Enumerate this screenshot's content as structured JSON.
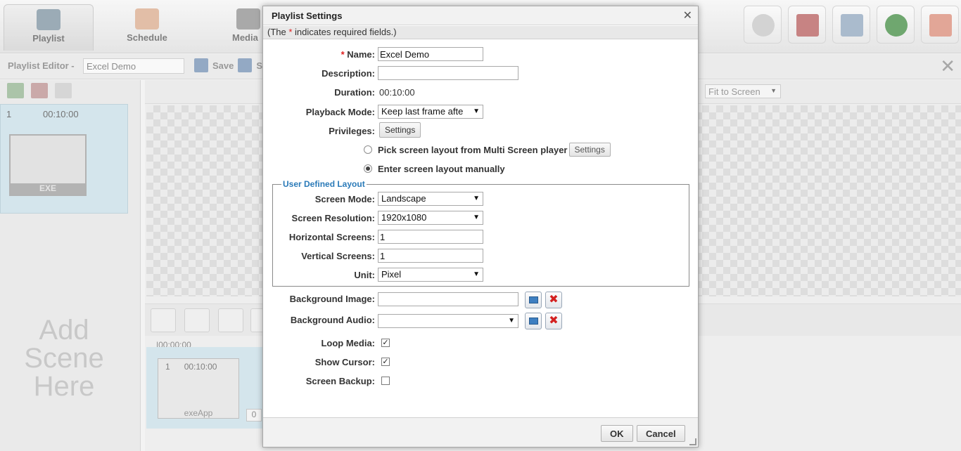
{
  "app": {
    "nav_tabs": [
      {
        "label": "Playlist",
        "icon": "playlist-icon"
      },
      {
        "label": "Schedule",
        "icon": "calendar-icon"
      },
      {
        "label": "Media",
        "icon": "media-icon"
      }
    ],
    "editor": {
      "label": "Playlist Editor -",
      "playlist_name": "Excel Demo",
      "save_label": "Save",
      "save_partial": "S"
    },
    "scene": {
      "index": "1",
      "duration": "00:10:00",
      "thumb_caption": "EXE"
    },
    "add_scene_text": [
      "Add",
      "Scene",
      "Here"
    ],
    "fit_select": "Fit to Screen",
    "timeline": {
      "ruler": "|00:00:00",
      "clip_index": "1",
      "clip_duration": "00:10:00",
      "clip_caption": "exeApp",
      "zero": "0"
    }
  },
  "dialog": {
    "title": "Playlist Settings",
    "required_note_before": "(The ",
    "required_star": "*",
    "required_note_after": " indicates required fields.)",
    "fields": {
      "name_label": "Name:",
      "name_value": "Excel Demo",
      "description_label": "Description:",
      "description_value": "",
      "duration_label": "Duration:",
      "duration_value": "00:10:00",
      "playback_label": "Playback Mode:",
      "playback_value": "Keep last frame afte",
      "privileges_label": "Privileges:",
      "privileges_button": "Settings"
    },
    "layout_options": {
      "pick_label": "Pick screen layout from Multi Screen player",
      "pick_button": "Settings",
      "manual_label": "Enter screen layout manually",
      "selected": "manual"
    },
    "user_layout": {
      "legend": "User Defined Layout",
      "screen_mode_label": "Screen Mode:",
      "screen_mode_value": "Landscape",
      "resolution_label": "Screen Resolution:",
      "resolution_value": "1920x1080",
      "horizontal_label": "Horizontal Screens:",
      "horizontal_value": "1",
      "vertical_label": "Vertical Screens:",
      "vertical_value": "1",
      "unit_label": "Unit:",
      "unit_value": "Pixel"
    },
    "background": {
      "image_label": "Background Image:",
      "image_value": "",
      "audio_label": "Background Audio:",
      "audio_value": ""
    },
    "options": {
      "loop_label": "Loop Media:",
      "loop_checked": true,
      "cursor_label": "Show Cursor:",
      "cursor_checked": true,
      "backup_label": "Screen Backup:",
      "backup_checked": false
    },
    "footer": {
      "ok_label": "OK",
      "cancel_label": "Cancel"
    }
  },
  "colors": {
    "accent_blue": "#2a7ab8",
    "required_red": "#e02020",
    "scene_highlight": "#c6dde6"
  }
}
